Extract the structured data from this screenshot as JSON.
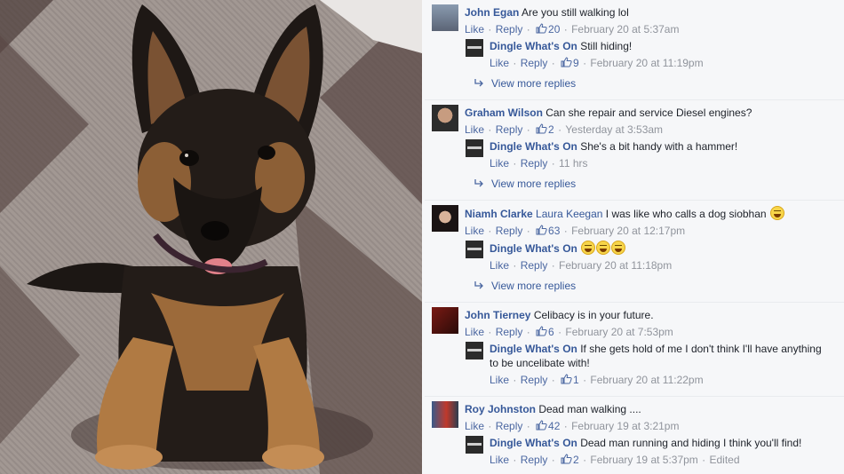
{
  "threads": [
    {
      "comment": {
        "author": "John Egan",
        "text": "Are you still walking lol",
        "like": "Like",
        "reply": "Reply",
        "likes": "20",
        "time": "February 20 at 5:37am"
      },
      "reply": {
        "author": "Dingle What's On",
        "text": "Still hiding!",
        "like": "Like",
        "reply": "Reply",
        "likes": "9",
        "time": "February 20 at 11:19pm"
      },
      "more": "View more replies"
    },
    {
      "comment": {
        "author": "Graham Wilson",
        "text": "Can she repair and service Diesel engines?",
        "like": "Like",
        "reply": "Reply",
        "likes": "2",
        "time": "Yesterday at 3:53am"
      },
      "reply": {
        "author": "Dingle What's On",
        "text": "She's a bit handy with a hammer!",
        "like": "Like",
        "reply": "Reply",
        "time": "11 hrs"
      },
      "more": "View more replies"
    },
    {
      "comment": {
        "author": "Niamh Clarke",
        "tag": "Laura Keegan",
        "text": "I was like who calls a dog siobhan",
        "like": "Like",
        "reply": "Reply",
        "likes": "63",
        "time": "February 20 at 12:17pm"
      },
      "reply": {
        "author": "Dingle What's On",
        "text": "",
        "like": "Like",
        "reply": "Reply",
        "time": "February 20 at 11:18pm"
      },
      "more": "View more replies"
    },
    {
      "comment": {
        "author": "John Tierney",
        "text": "Celibacy is in your future.",
        "like": "Like",
        "reply": "Reply",
        "likes": "6",
        "time": "February 20 at 7:53pm"
      },
      "reply": {
        "author": "Dingle What's On",
        "text": "If she gets hold of me I don't think I'll have anything",
        "text2": "to be uncelibate with!",
        "like": "Like",
        "reply": "Reply",
        "likes": "1",
        "time": "February 20 at 11:22pm"
      }
    },
    {
      "comment": {
        "author": "Roy Johnston",
        "text": "Dead man walking ....",
        "like": "Like",
        "reply": "Reply",
        "likes": "42",
        "time": "February 19 at 3:21pm"
      },
      "reply": {
        "author": "Dingle What's On",
        "text": "Dead man running and hiding I think you'll find!",
        "like": "Like",
        "reply": "Reply",
        "likes": "2",
        "time": "February 19 at 5:37pm",
        "edited": "Edited"
      }
    }
  ],
  "colors": {
    "link": "#365899",
    "meta": "#90949c",
    "panel": "#f6f7f9"
  }
}
